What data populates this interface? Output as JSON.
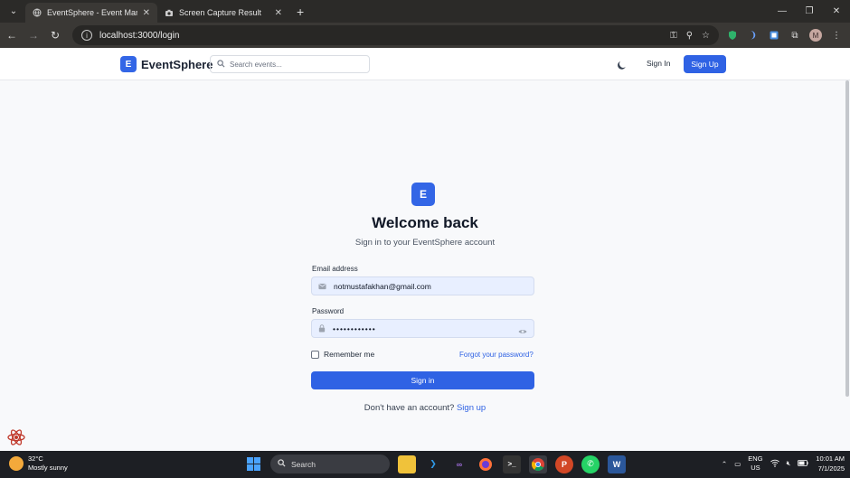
{
  "browser": {
    "tabs": [
      {
        "title": "EventSphere - Event Manageme",
        "active": true
      },
      {
        "title": "Screen Capture Result",
        "active": false
      }
    ],
    "url": "localhost:3000/login"
  },
  "header": {
    "logo_letter": "E",
    "brand": "EventSphere",
    "search_placeholder": "Search events...",
    "signin_label": "Sign In",
    "signup_label": "Sign Up"
  },
  "login": {
    "logo_letter": "E",
    "title": "Welcome back",
    "subtitle": "Sign in to your EventSphere account",
    "email_label": "Email address",
    "email_value": "notmustafakhan@gmail.com",
    "password_label": "Password",
    "password_value": "••••••••••••",
    "remember_label": "Remember me",
    "forgot_label": "Forgot your password?",
    "submit_label": "Sign in",
    "no_account_text": "Don't have an account?",
    "signup_link": "Sign up"
  },
  "taskbar": {
    "weather_temp": "32°C",
    "weather_desc": "Mostly sunny",
    "search_label": "Search",
    "lang_top": "ENG",
    "lang_bottom": "US",
    "time": "10:01 AM",
    "date": "7/1/2025"
  },
  "colors": {
    "accent": "#2f62e4",
    "field_bg": "#e8efff"
  }
}
